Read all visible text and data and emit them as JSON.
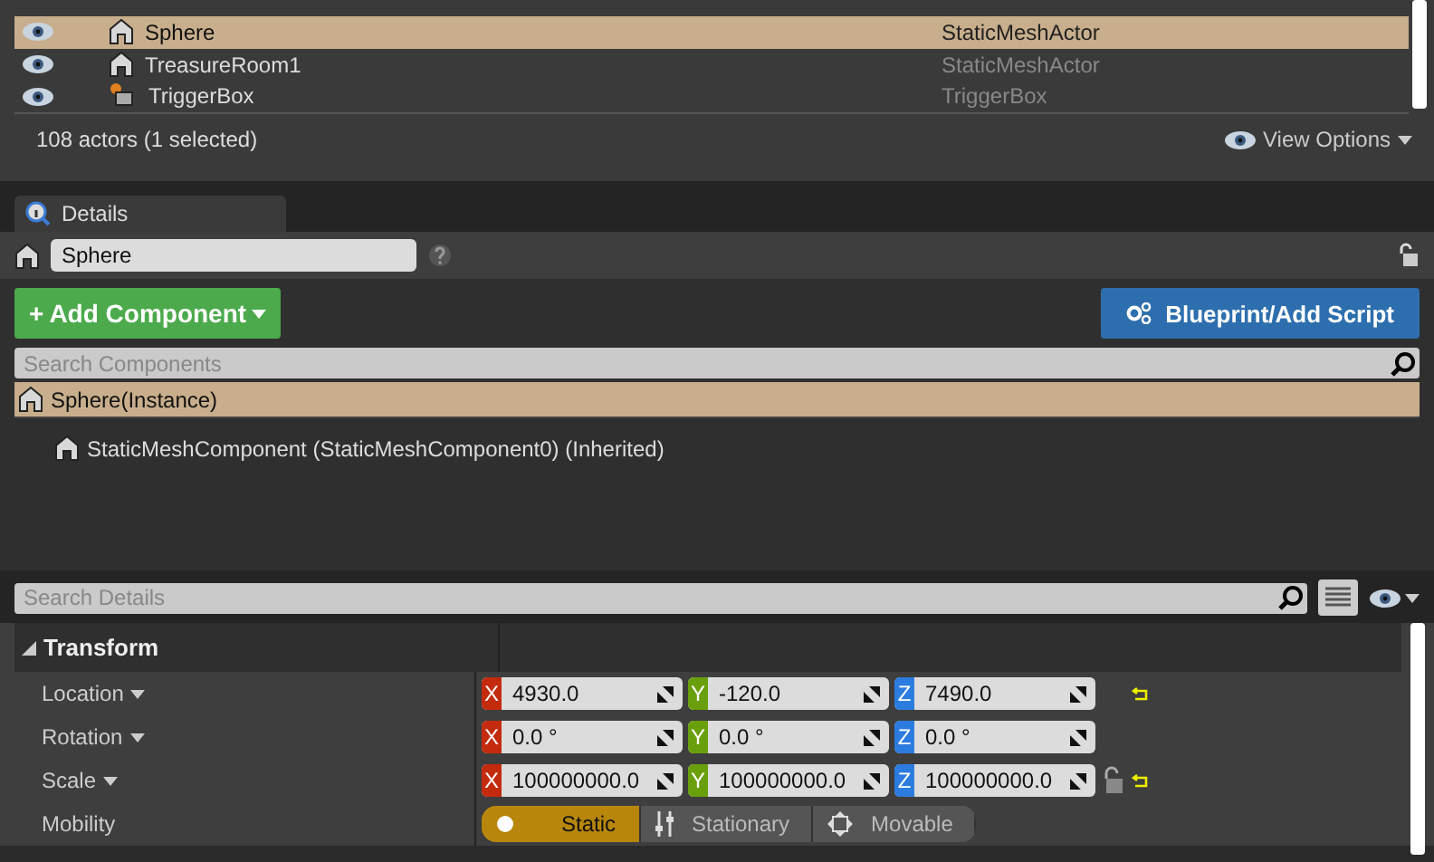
{
  "outliner": {
    "rows": [
      {
        "name": "Sphere",
        "type": "StaticMeshActor",
        "visible": true,
        "selected": true,
        "kind": "mesh"
      },
      {
        "name": "TreasureRoom1",
        "type": "StaticMeshActor",
        "visible": true,
        "selected": false,
        "kind": "mesh"
      },
      {
        "name": "TriggerBox",
        "type": "TriggerBox",
        "visible": true,
        "selected": false,
        "kind": "trigger"
      }
    ],
    "status": "108 actors (1 selected)",
    "view_options": "View Options"
  },
  "details": {
    "tab": "Details",
    "name": "Sphere",
    "add_component": "Add Component",
    "add_icon": "+",
    "blueprint_button": "Blueprint/Add Script",
    "search_components": "Search Components",
    "components": [
      {
        "name": "Sphere(Instance)",
        "selected": true,
        "children": [
          {
            "name": "StaticMeshComponent (StaticMeshComponent0) (Inherited)",
            "selected": false
          }
        ]
      }
    ],
    "search_details": "Search Details",
    "section": {
      "title": "Transform",
      "expanded": true,
      "properties": [
        {
          "kind": "vector",
          "label": "Location",
          "dropdown": true,
          "values": [
            {
              "axis": "X",
              "value": "4930.0"
            },
            {
              "axis": "Y",
              "value": "-120.0"
            },
            {
              "axis": "Z",
              "value": "7490.0"
            }
          ],
          "lock": false,
          "reset": true
        },
        {
          "kind": "vector",
          "label": "Rotation",
          "dropdown": true,
          "values": [
            {
              "axis": "X",
              "value": "0.0 °"
            },
            {
              "axis": "Y",
              "value": "0.0 °"
            },
            {
              "axis": "Z",
              "value": "0.0 °"
            }
          ],
          "lock": false,
          "reset": false
        },
        {
          "kind": "vector",
          "label": "Scale",
          "dropdown": true,
          "values": [
            {
              "axis": "X",
              "value": "100000000.0"
            },
            {
              "axis": "Y",
              "value": "100000000.0"
            },
            {
              "axis": "Z",
              "value": "100000000.0"
            }
          ],
          "lock": true,
          "reset": true
        },
        {
          "kind": "mobility",
          "label": "Mobility",
          "dropdown": false,
          "options": [
            {
              "label": "Static",
              "selected": true
            },
            {
              "label": "Stationary",
              "selected": false
            },
            {
              "label": "Movable",
              "selected": false
            }
          ]
        }
      ]
    }
  }
}
